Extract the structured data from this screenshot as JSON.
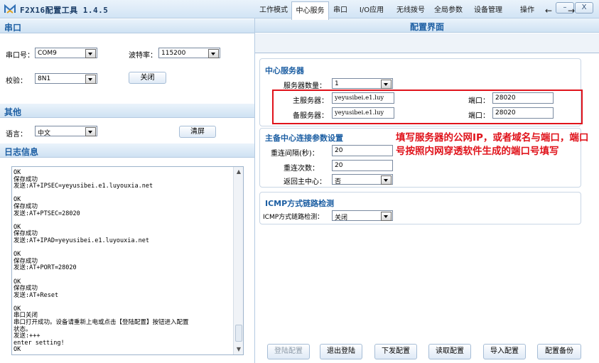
{
  "window": {
    "title": "F2X16配置工具 1.4.5",
    "minimize": "–",
    "close": "X"
  },
  "serial": {
    "header": "串口",
    "port_label": "串口号：",
    "port_value": "COM9",
    "baud_label": "波特率：",
    "baud_value": "115200",
    "parity_label": "校验：",
    "parity_value": "8N1",
    "close_btn": "关闭"
  },
  "other": {
    "header": "其他",
    "lang_label": "语言：",
    "lang_value": "中文",
    "clear_btn": "清屏"
  },
  "log": {
    "header": "日志信息",
    "lines": "OK\n保存成功\n发送:AT+IPSEC=yeyusibei.e1.luyouxia.net\n\nOK\n保存成功\n发送:AT+PTSEC=28020\n\nOK\n保存成功\n发送:AT+IPAD=yeyusibei.e1.luyouxia.net\n\nOK\n保存成功\n发送:AT+PORT=28020\n\nOK\n保存成功\n发送:AT+Reset\n\nOK\n串口关闭\n串口打开成功。设备请重新上电或点击【登陆配置】按钮进入配置\n状态。\n发送:+++\nenter setting!\nOK"
  },
  "config": {
    "header": "配置界面",
    "tabs": [
      "工作模式",
      "中心服务",
      "串口",
      "I/O应用",
      "无线拨号",
      "全局参数",
      "设备管理",
      "操作"
    ],
    "nav_prev": "←",
    "nav_next": "→",
    "center_server": {
      "title": "中心服务器",
      "count_label": "服务器数量：",
      "count_value": "1",
      "main_label": "主服务器：",
      "main_value": "yeyusibei.e1.luy",
      "main_port_label": "端口：",
      "main_port_value": "28020",
      "backup_label": "备服务器：",
      "backup_value": "yeyusibei.e1.luy",
      "backup_port_label": "端口：",
      "backup_port_value": "28020"
    },
    "connect": {
      "title": "主备中心连接参数设置",
      "interval_label": "重连间隔(秒)：",
      "interval_value": "20",
      "retry_label": "重连次数：",
      "retry_value": "20",
      "back_label": "返回主中心：",
      "back_value": "否"
    },
    "icmp": {
      "title": "ICMP方式链路检测",
      "label": "ICMP方式链路检测：",
      "value": "关闭"
    },
    "annotation": "填写服务器的公网IP，或者域名与端口，端口号按照内网穿透软件生成的端口号填写",
    "buttons": [
      "登陆配置",
      "退出登陆",
      "下发配置",
      "读取配置",
      "导入配置",
      "配置备份"
    ]
  },
  "colors": {
    "accent": "#1d5fa3",
    "annotation_red": "#e0131b"
  }
}
